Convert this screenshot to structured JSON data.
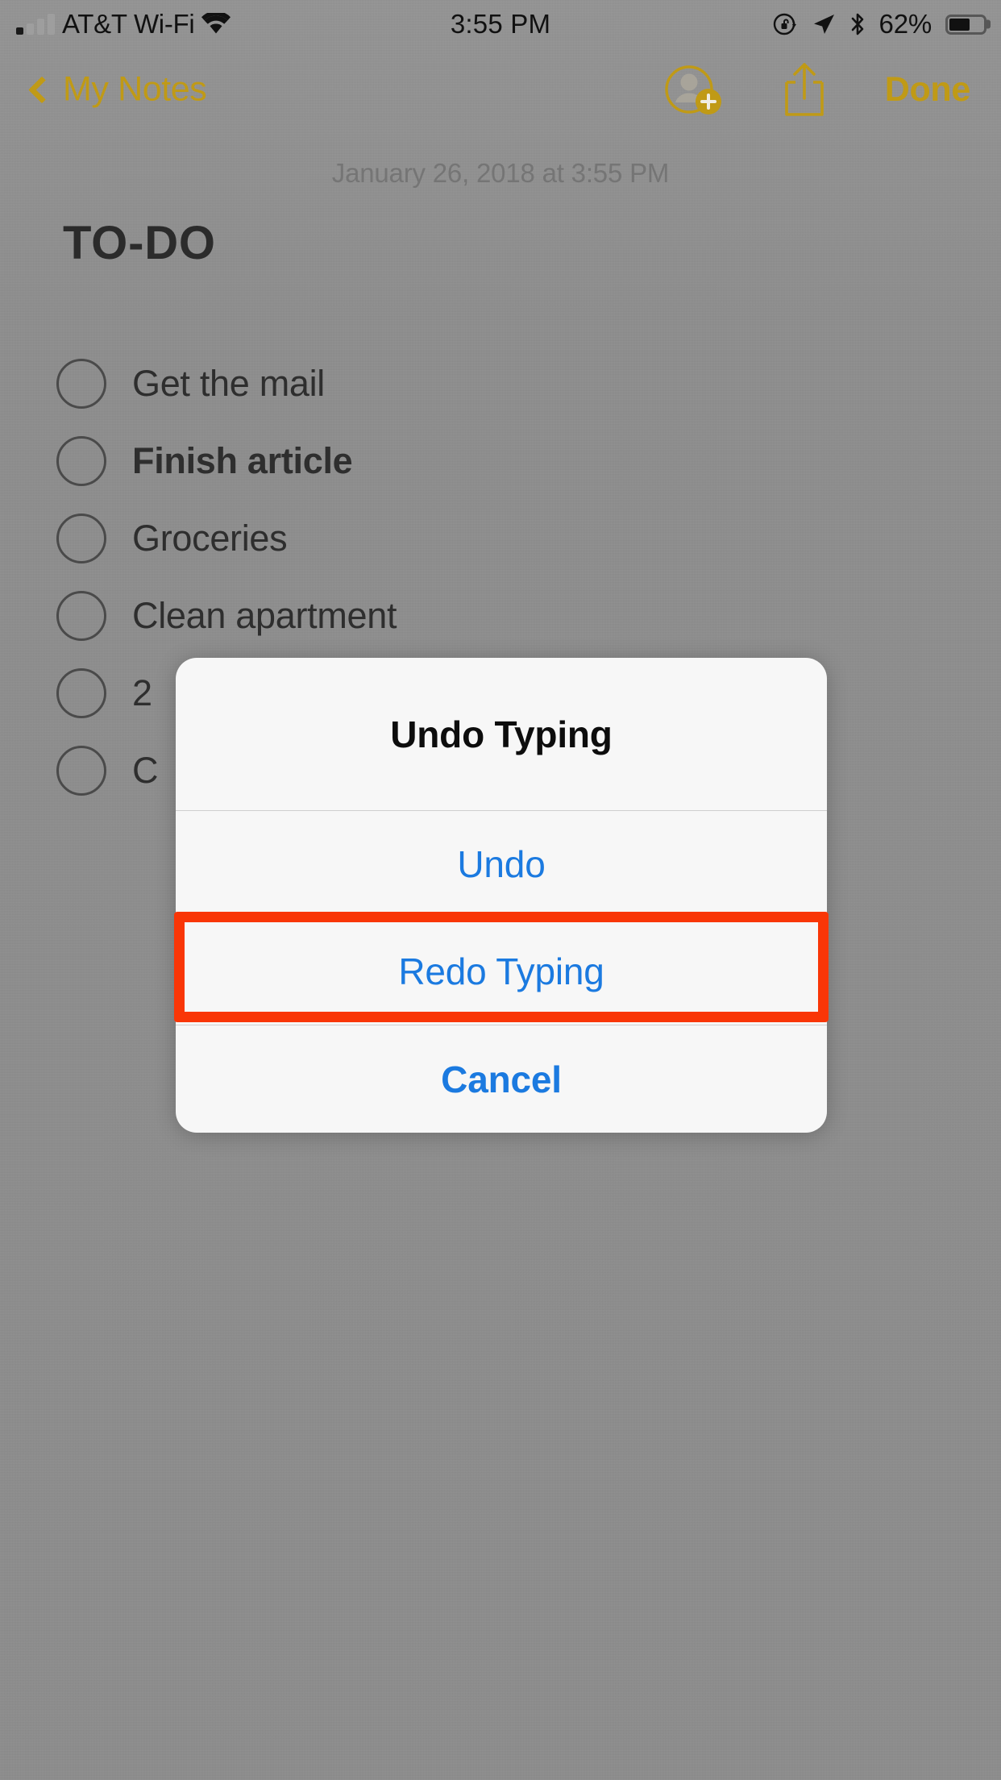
{
  "status_bar": {
    "carrier": "AT&T Wi-Fi",
    "wifi_icon": "wifi-icon",
    "signal_icon": "cellular-signal-icon",
    "time": "3:55 PM",
    "rotation_lock_icon": "rotation-lock-icon",
    "location_icon": "location-arrow-icon",
    "bluetooth_icon": "bluetooth-icon",
    "battery_percent": "62%",
    "battery_icon": "battery-icon",
    "battery_level": 62
  },
  "nav_bar": {
    "back_label": "My Notes",
    "back_chevron_icon": "chevron-left-icon",
    "add_person_icon": "add-person-icon",
    "share_icon": "share-icon",
    "done_label": "Done",
    "accent_color": "#c09a16"
  },
  "note": {
    "date": "January 26, 2018 at 3:55 PM",
    "title": "TO-DO",
    "checklist": [
      {
        "text": "Get the mail",
        "bold": false,
        "checked": false
      },
      {
        "text": "Finish article",
        "bold": true,
        "checked": false
      },
      {
        "text": "Groceries",
        "bold": false,
        "checked": false
      },
      {
        "text": "Clean apartment",
        "bold": false,
        "checked": false
      },
      {
        "text": "2",
        "bold": false,
        "checked": false
      },
      {
        "text": "C",
        "bold": false,
        "checked": false
      }
    ]
  },
  "alert": {
    "title": "Undo Typing",
    "buttons": [
      {
        "label": "Undo",
        "style": "default"
      },
      {
        "label": "Redo Typing",
        "style": "default"
      },
      {
        "label": "Cancel",
        "style": "cancel"
      }
    ],
    "button_color": "#1b7ae0"
  },
  "annotation": {
    "target": "Redo Typing",
    "color": "#f93607"
  }
}
